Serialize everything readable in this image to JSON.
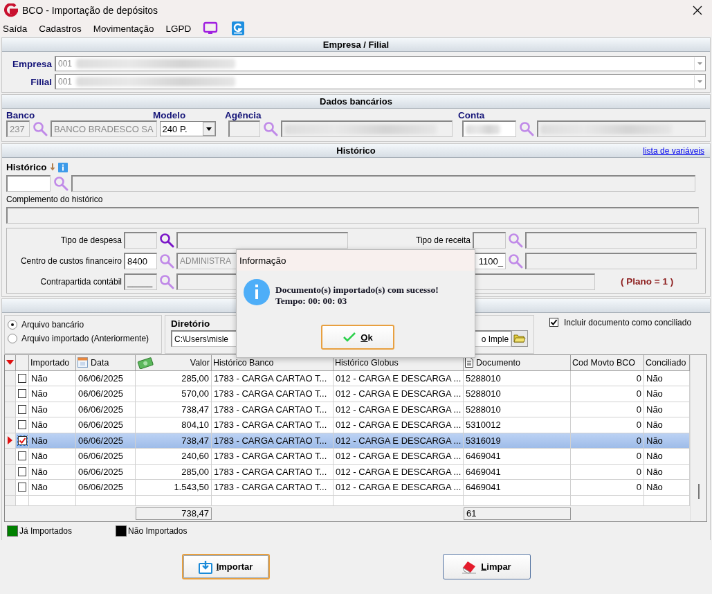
{
  "window": {
    "title": "BCO - Importação de depósitos"
  },
  "menu": [
    {
      "label": "Saída"
    },
    {
      "label": "Cadastros"
    },
    {
      "label": "Movimentação"
    },
    {
      "label": "LGPD"
    }
  ],
  "empresa_filial": {
    "title": "Empresa / Filial",
    "fields": [
      {
        "label": "Empresa",
        "value": "001"
      },
      {
        "label": "Filial",
        "value": "001"
      }
    ]
  },
  "dados_bancarios": {
    "title": "Dados bancários",
    "banco": {
      "label": "Banco",
      "code": "237",
      "name": "BANCO BRADESCO SA"
    },
    "modelo": {
      "label": "Modelo",
      "value": "240 P."
    },
    "agencia": {
      "label": "Agência"
    },
    "conta": {
      "label": "Conta"
    }
  },
  "historico": {
    "title": "Histórico",
    "link": "lista de variáveis",
    "label": "Histórico",
    "complemento_label": "Complemento do histórico",
    "tipo_despesa": {
      "label": "Tipo de despesa"
    },
    "tipo_receita": {
      "label": "Tipo de receita"
    },
    "centro_custos": {
      "label": "Centro de custos financeiro",
      "code": "8400",
      "name": "ADMINISTRA"
    },
    "centro_custos_receita": {
      "code": "1100_"
    },
    "contrapartida": {
      "label": "Contrapartida contábil",
      "code": "_____"
    },
    "plano": "( Plano = 1 )"
  },
  "importacao": {
    "sources": [
      {
        "label": "Arquivo bancário",
        "selected": true
      },
      {
        "label": "Arquivo importado (Anteriormente)",
        "selected": false
      }
    ],
    "diretorio": {
      "label": "Diretório",
      "value_start": "C:\\Users\\misle",
      "value_end": "o Imple"
    },
    "incluir_conciliado": {
      "label": "Incluir documento como conciliado",
      "checked": true
    }
  },
  "table": {
    "columns": [
      "Importado",
      "Data",
      "Valor",
      "Histórico Banco",
      "Histórico Globus",
      "Documento",
      "Cod Movto BCO",
      "Conciliado"
    ],
    "rows": [
      {
        "checked": false,
        "selected": false,
        "importado": "Não",
        "data": "06/06/2025",
        "valor": "285,00",
        "historico_banco": "1783 - CARGA CARTAO T...",
        "historico_globus": "012 - CARGA E DESCARGA ...",
        "documento": "5288010",
        "cod_movto": "0",
        "conciliado": "Não"
      },
      {
        "checked": false,
        "selected": false,
        "importado": "Não",
        "data": "06/06/2025",
        "valor": "570,00",
        "historico_banco": "1783 - CARGA CARTAO T...",
        "historico_globus": "012 - CARGA E DESCARGA ...",
        "documento": "5288010",
        "cod_movto": "0",
        "conciliado": "Não"
      },
      {
        "checked": false,
        "selected": false,
        "importado": "Não",
        "data": "06/06/2025",
        "valor": "738,47",
        "historico_banco": "1783 - CARGA CARTAO T...",
        "historico_globus": "012 - CARGA E DESCARGA ...",
        "documento": "5288010",
        "cod_movto": "0",
        "conciliado": "Não"
      },
      {
        "checked": false,
        "selected": false,
        "importado": "Não",
        "data": "06/06/2025",
        "valor": "804,10",
        "historico_banco": "1783 - CARGA CARTAO T...",
        "historico_globus": "012 - CARGA E DESCARGA ...",
        "documento": "5310012",
        "cod_movto": "0",
        "conciliado": "Não"
      },
      {
        "checked": true,
        "selected": true,
        "importado": "Não",
        "data": "06/06/2025",
        "valor": "738,47",
        "historico_banco": "1783 - CARGA CARTAO T...",
        "historico_globus": "012 - CARGA E DESCARGA ...",
        "documento": "5316019",
        "cod_movto": "0",
        "conciliado": "Não"
      },
      {
        "checked": false,
        "selected": false,
        "importado": "Não",
        "data": "06/06/2025",
        "valor": "240,60",
        "historico_banco": "1783 - CARGA CARTAO T...",
        "historico_globus": "012 - CARGA E DESCARGA ...",
        "documento": "6469041",
        "cod_movto": "0",
        "conciliado": "Não"
      },
      {
        "checked": false,
        "selected": false,
        "importado": "Não",
        "data": "06/06/2025",
        "valor": "285,00",
        "historico_banco": "1783 - CARGA CARTAO T...",
        "historico_globus": "012 - CARGA E DESCARGA ...",
        "documento": "6469041",
        "cod_movto": "0",
        "conciliado": "Não"
      },
      {
        "checked": false,
        "selected": false,
        "importado": "Não",
        "data": "06/06/2025",
        "valor": "1.543,50",
        "historico_banco": "1783 - CARGA CARTAO T...",
        "historico_globus": "012 - CARGA E DESCARGA ...",
        "documento": "6469041",
        "cod_movto": "0",
        "conciliado": "Não"
      }
    ],
    "totals": {
      "valor": "738,47",
      "documento": "61"
    }
  },
  "legend": [
    {
      "label": "Já Importados",
      "color": "#008000"
    },
    {
      "label": "Não Importados",
      "color": "#000000"
    }
  ],
  "buttons": [
    {
      "label": "Importar",
      "kind": "import",
      "default": true
    },
    {
      "label": "Limpar",
      "kind": "clear",
      "default": false
    }
  ],
  "dialog": {
    "title": "Informação",
    "lines": [
      "Documento(s) importado(s) com sucesso!",
      "Tempo: 00: 00: 03"
    ],
    "button": "Ok"
  }
}
